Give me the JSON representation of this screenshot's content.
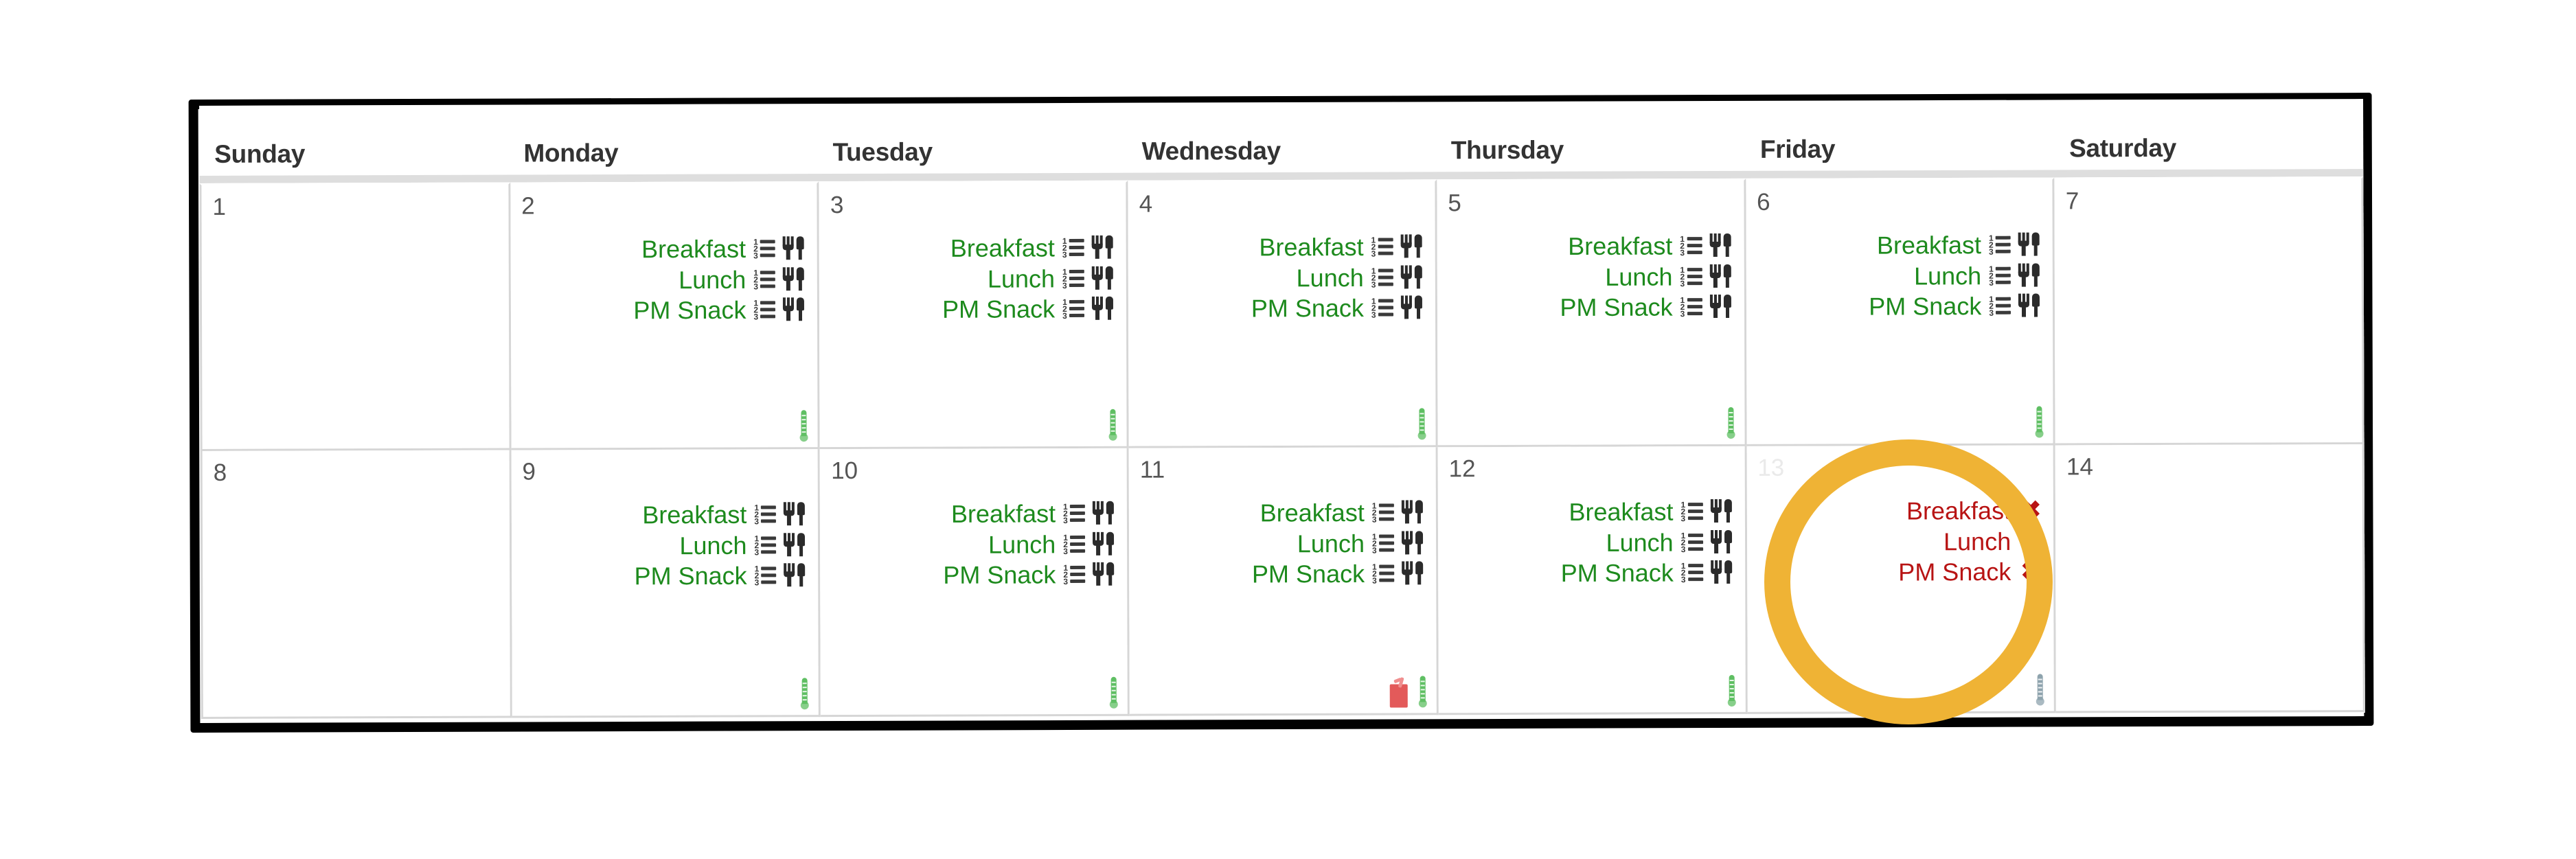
{
  "calendar": {
    "weekday_headers": [
      "Sunday",
      "Monday",
      "Tuesday",
      "Wednesday",
      "Thursday",
      "Friday",
      "Saturday"
    ],
    "meal_labels": {
      "breakfast": "Breakfast",
      "lunch": "Lunch",
      "pm_snack": "PM Snack"
    },
    "icons": {
      "list": "ordered-list-icon",
      "utensils": "fork-knife-icon",
      "blocked": "✖",
      "thermometer_green": "thermometer-green-icon",
      "thermometer_grey": "thermometer-grey-icon",
      "drink_red": "drink-red-icon"
    },
    "colors": {
      "meal_available": "#1d8a1d",
      "meal_blocked": "#b81414",
      "header_text": "#333333",
      "day_number": "#555555",
      "grid_line": "#d6d6d6",
      "frame": "#010101",
      "annotation_highlight": "#efb335",
      "thermometer_green": "#5fbf63",
      "thermometer_grey": "#8ea3ad",
      "drink_red": "#e35a5a"
    },
    "weeks": [
      [
        {
          "day": "1",
          "meals": [],
          "status": []
        },
        {
          "day": "2",
          "meals": [
            {
              "label": "Breakfast",
              "state": "available"
            },
            {
              "label": "Lunch",
              "state": "available"
            },
            {
              "label": "PM Snack",
              "state": "available"
            }
          ],
          "status": [
            "thermometer_green"
          ]
        },
        {
          "day": "3",
          "meals": [
            {
              "label": "Breakfast",
              "state": "available"
            },
            {
              "label": "Lunch",
              "state": "available"
            },
            {
              "label": "PM Snack",
              "state": "available"
            }
          ],
          "status": [
            "thermometer_green"
          ]
        },
        {
          "day": "4",
          "meals": [
            {
              "label": "Breakfast",
              "state": "available"
            },
            {
              "label": "Lunch",
              "state": "available"
            },
            {
              "label": "PM Snack",
              "state": "available"
            }
          ],
          "status": [
            "thermometer_green"
          ]
        },
        {
          "day": "5",
          "meals": [
            {
              "label": "Breakfast",
              "state": "available"
            },
            {
              "label": "Lunch",
              "state": "available"
            },
            {
              "label": "PM Snack",
              "state": "available"
            }
          ],
          "status": [
            "thermometer_green"
          ]
        },
        {
          "day": "6",
          "meals": [
            {
              "label": "Breakfast",
              "state": "available"
            },
            {
              "label": "Lunch",
              "state": "available"
            },
            {
              "label": "PM Snack",
              "state": "available"
            }
          ],
          "status": [
            "thermometer_green"
          ]
        },
        {
          "day": "7",
          "meals": [],
          "status": []
        }
      ],
      [
        {
          "day": "8",
          "meals": [],
          "status": []
        },
        {
          "day": "9",
          "meals": [
            {
              "label": "Breakfast",
              "state": "available"
            },
            {
              "label": "Lunch",
              "state": "available"
            },
            {
              "label": "PM Snack",
              "state": "available"
            }
          ],
          "status": [
            "thermometer_green"
          ]
        },
        {
          "day": "10",
          "meals": [
            {
              "label": "Breakfast",
              "state": "available"
            },
            {
              "label": "Lunch",
              "state": "available"
            },
            {
              "label": "PM Snack",
              "state": "available"
            }
          ],
          "status": [
            "thermometer_green"
          ]
        },
        {
          "day": "11",
          "meals": [
            {
              "label": "Breakfast",
              "state": "available"
            },
            {
              "label": "Lunch",
              "state": "available"
            },
            {
              "label": "PM Snack",
              "state": "available"
            }
          ],
          "status": [
            "drink_red",
            "thermometer_green"
          ]
        },
        {
          "day": "12",
          "meals": [
            {
              "label": "Breakfast",
              "state": "available"
            },
            {
              "label": "Lunch",
              "state": "available"
            },
            {
              "label": "PM Snack",
              "state": "available"
            }
          ],
          "status": [
            "thermometer_green"
          ]
        },
        {
          "day": "13",
          "meals": [
            {
              "label": "Breakfast",
              "state": "blocked"
            },
            {
              "label": "Lunch",
              "state": "blocked"
            },
            {
              "label": "PM Snack",
              "state": "blocked"
            }
          ],
          "status": [
            "thermometer_grey"
          ],
          "highlighted": true
        },
        {
          "day": "14",
          "meals": [],
          "status": []
        }
      ]
    ]
  }
}
